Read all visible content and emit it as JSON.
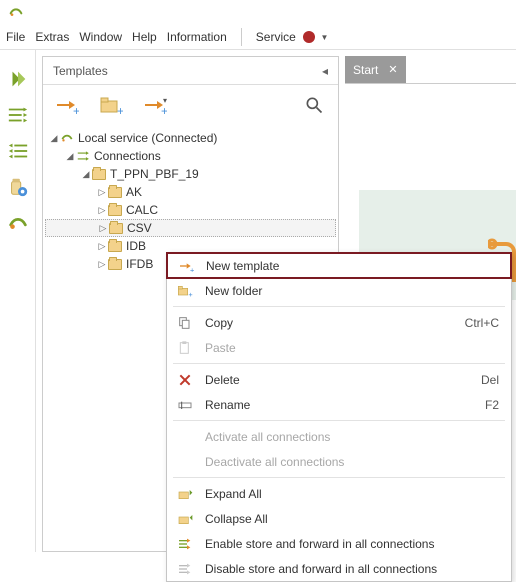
{
  "menubar": {
    "items": [
      "File",
      "Extras",
      "Window",
      "Help",
      "Information"
    ],
    "service_label": "Service",
    "status_color": "#b02a2a"
  },
  "sidebar": {
    "icons": [
      "template-icon",
      "rightarrows-icon",
      "leftarrows-icon",
      "jar-gear-icon",
      "swirl-icon"
    ]
  },
  "templates": {
    "title": "Templates",
    "tools": [
      "new-template-tool",
      "new-folder-tool",
      "export-tool",
      "search-tool"
    ],
    "root": {
      "label": "Local service (Connected)",
      "connections_label": "Connections",
      "group": {
        "label": "T_PPN_PBF_19",
        "children": [
          "AK",
          "CALC",
          "CSV",
          "IDB",
          "IFDB"
        ],
        "selected_index": 2
      }
    }
  },
  "tabs": {
    "start": {
      "label": "Start"
    }
  },
  "context_menu": {
    "items": [
      {
        "label": "New template",
        "icon": "new-template-icon",
        "highlighted": true
      },
      {
        "label": "New folder",
        "icon": "new-folder-icon"
      },
      {
        "sep": true
      },
      {
        "label": "Copy",
        "icon": "copy-icon",
        "shortcut": "Ctrl+C"
      },
      {
        "label": "Paste",
        "icon": "paste-icon",
        "disabled": true
      },
      {
        "sep": true
      },
      {
        "label": "Delete",
        "icon": "delete-icon",
        "shortcut": "Del"
      },
      {
        "label": "Rename",
        "icon": "rename-icon",
        "shortcut": "F2"
      },
      {
        "sep": true
      },
      {
        "label": "Activate all connections",
        "disabled": true
      },
      {
        "label": "Deactivate all connections",
        "disabled": true
      },
      {
        "sep": true
      },
      {
        "label": "Expand All",
        "icon": "expand-icon"
      },
      {
        "label": "Collapse All",
        "icon": "collapse-icon"
      },
      {
        "label": "Enable store and forward in all connections",
        "icon": "enable-sf-icon"
      },
      {
        "label": "Disable store and forward in all connections",
        "icon": "disable-sf-icon"
      }
    ]
  }
}
